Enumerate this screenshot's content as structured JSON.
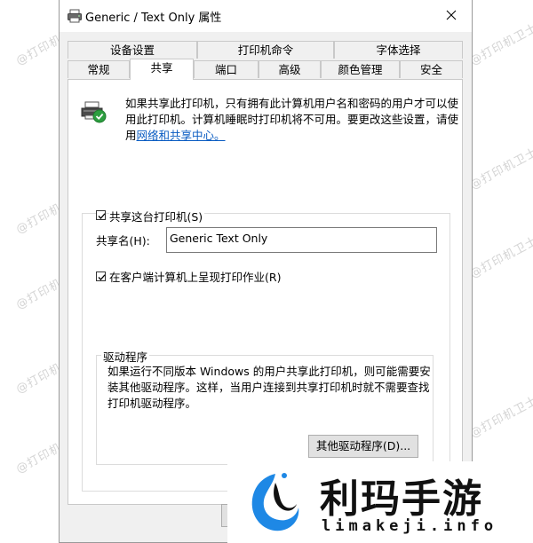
{
  "window": {
    "title": "Generic / Text Only 属性",
    "close_label": "✕"
  },
  "tabs_row1": [
    "设备设置",
    "打印机命令",
    "字体选择"
  ],
  "tabs_row2": [
    "常规",
    "共享",
    "端口",
    "高级",
    "颜色管理",
    "安全"
  ],
  "active_tab": "共享",
  "sharing": {
    "info_text_part1": "如果共享此打印机，只有拥有此计算机用户名和密码的用户才可以使用此打印机。计算机睡眠时打印机将不可用。要更改这些设置，请使用",
    "info_link": "网络和共享中心。",
    "share_checkbox_label": "共享这台打印机(S)",
    "share_checked": true,
    "share_name_label": "共享名(H):",
    "share_name_value": "Generic  Text Only",
    "render_jobs_label": "在客户端计算机上呈现打印作业(R)",
    "render_jobs_checked": true
  },
  "drivers": {
    "group_title": "驱动程序",
    "description": "如果运行不同版本 Windows 的用户共享此打印机，则可能需要安装其他驱动程序。这样，当用户连接到共享打印机时就不需要查找打印机驱动程序。",
    "button_label": "其他驱动程序(D)..."
  },
  "watermark_text": "@打印机卫士",
  "overlay_logo": {
    "title": "利玛手游",
    "subtitle": "limakeji.info"
  }
}
